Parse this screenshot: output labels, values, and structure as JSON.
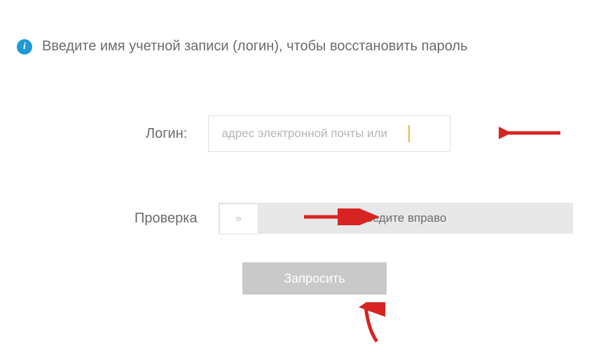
{
  "instruction": "Введите имя учетной записи (логин), чтобы восстановить пароль",
  "info_icon_char": "i",
  "form": {
    "login": {
      "label": "Логин:",
      "placeholder": "адрес электронной почты или "
    },
    "captcha": {
      "label": "Проверка",
      "slider_text": "Проведите вправо",
      "handle_symbol": "»"
    },
    "submit": {
      "label": "Запросить"
    }
  },
  "annotation_color": "#d82323"
}
